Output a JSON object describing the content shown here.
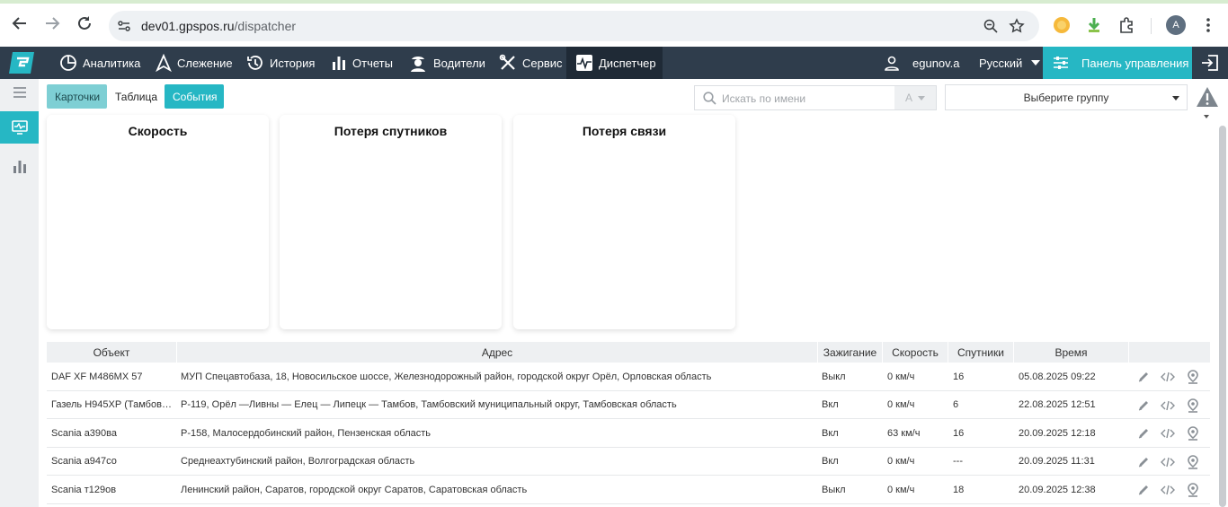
{
  "browser": {
    "url_host": "dev01.gpspos.ru",
    "url_path": "/dispatcher",
    "profile_initial": "A"
  },
  "topnav": {
    "items": [
      {
        "label": "Аналитика",
        "icon": "analytics-icon"
      },
      {
        "label": "Слежение",
        "icon": "tracking-icon"
      },
      {
        "label": "История",
        "icon": "history-icon"
      },
      {
        "label": "Отчеты",
        "icon": "reports-icon"
      },
      {
        "label": "Водители",
        "icon": "drivers-icon"
      },
      {
        "label": "Сервис",
        "icon": "service-icon"
      },
      {
        "label": "Диспетчер",
        "icon": "dispatcher-icon"
      }
    ],
    "username": "egunov.a",
    "language": "Русский",
    "panel_label": "Панель управления"
  },
  "toolbar": {
    "view_cards": "Карточки",
    "view_table": "Таблица",
    "view_events": "События",
    "search_placeholder": "Искать по имени",
    "sort_label": "A",
    "group_placeholder": "Выберите группу"
  },
  "cards": [
    {
      "title": "Скорость"
    },
    {
      "title": "Потеря спутников"
    },
    {
      "title": "Потеря связи"
    }
  ],
  "table": {
    "columns": {
      "object": "Объект",
      "address": "Адрес",
      "ignition": "Зажигание",
      "speed": "Скорость",
      "satellites": "Спутники",
      "time": "Время"
    },
    "rows": [
      {
        "object": "DAF XF М486МХ 57",
        "address": "МУП Спецавтобаза, 18, Новосильское шоссе, Железнодорожный район, городской округ Орёл, Орловская область",
        "ignition": "Выкл",
        "speed": "0 км/ч",
        "satellites": "16",
        "time": "05.08.2025 09:22"
      },
      {
        "object": "Газель Н945ХР (Тамбов…",
        "address": "Р-119, Орёл —Ливны — Елец — Липецк — Тамбов, Тамбовский муниципальный округ, Тамбовская область",
        "ignition": "Вкл",
        "speed": "0 км/ч",
        "satellites": "6",
        "time": "22.08.2025 12:51"
      },
      {
        "object": "Scania а390ва",
        "address": "Р-158, Малосердобинский район, Пензенская область",
        "ignition": "Вкл",
        "speed": "63 км/ч",
        "satellites": "16",
        "time": "20.09.2025 12:18"
      },
      {
        "object": "Scania а947со",
        "address": "Среднеахтубинский район, Волгоградская область",
        "ignition": "Вкл",
        "speed": "0 км/ч",
        "satellites": "---",
        "time": "20.09.2025 11:31"
      },
      {
        "object": "Scania т129ов",
        "address": "Ленинский район, Саратов, городской округ Саратов, Саратовская область",
        "ignition": "Выкл",
        "speed": "0 км/ч",
        "satellites": "18",
        "time": "20.09.2025 12:38"
      }
    ]
  },
  "colors": {
    "accent": "#26b7c4",
    "topnav_bg": "#2f3d4c",
    "cards_button_bg": "#7ecfd4"
  }
}
